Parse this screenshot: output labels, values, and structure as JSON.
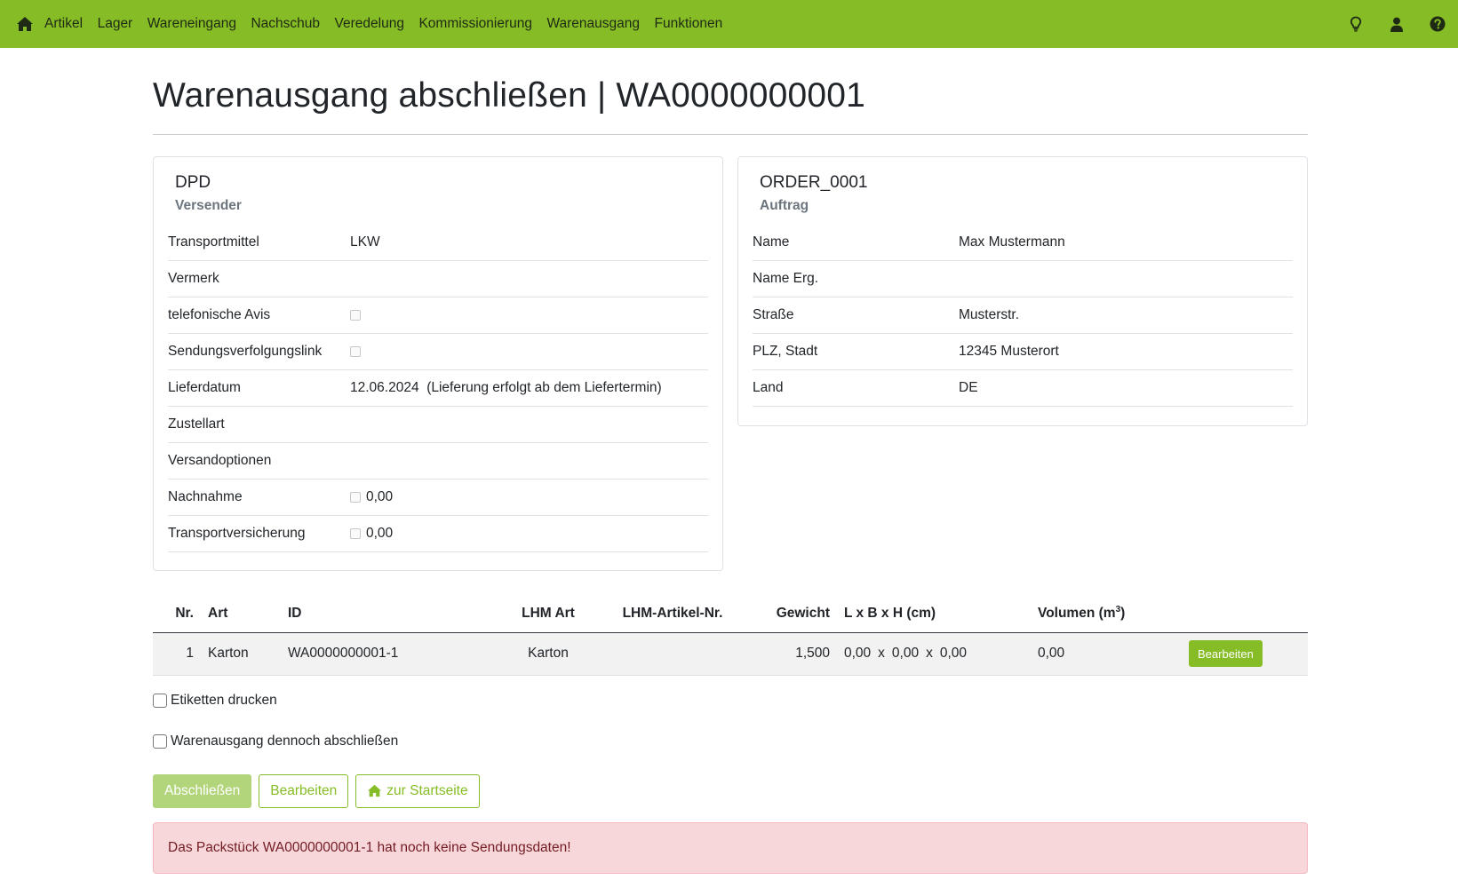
{
  "navbar": {
    "items": [
      "Artikel",
      "Lager",
      "Wareneingang",
      "Nachschub",
      "Veredelung",
      "Kommissionierung",
      "Warenausgang",
      "Funktionen"
    ],
    "icons": [
      "home-icon",
      "lightbulb-icon",
      "user-icon",
      "help-icon"
    ],
    "accent_color": "#86bc25"
  },
  "page": {
    "title": "Warenausgang abschließen | WA0000000001"
  },
  "shipper_card": {
    "title": "DPD",
    "subtitle": "Versender",
    "rows": {
      "transportmittel": {
        "label": "Transportmittel",
        "value": "LKW"
      },
      "vermerk": {
        "label": "Vermerk",
        "value": ""
      },
      "avis": {
        "label": "telefonische Avis",
        "checked": false
      },
      "tracking": {
        "label": "Sendungsverfolgungslink",
        "checked": false
      },
      "lieferdatum": {
        "label": "Lieferdatum",
        "value": "12.06.2024  (Lieferung erfolgt ab dem Liefertermin)"
      },
      "zustellart": {
        "label": "Zustellart",
        "value": ""
      },
      "versandoptionen": {
        "label": "Versandoptionen",
        "value": ""
      },
      "nachnahme": {
        "label": "Nachnahme",
        "checked": false,
        "value": "0,00"
      },
      "versicherung": {
        "label": "Transportversicherung",
        "checked": false,
        "value": "0,00"
      }
    }
  },
  "order_card": {
    "title": "ORDER_0001",
    "subtitle": "Auftrag",
    "rows": {
      "name": {
        "label": "Name",
        "value": "Max Mustermann"
      },
      "name_erg": {
        "label": "Name Erg.",
        "value": ""
      },
      "strasse": {
        "label": "Straße",
        "value": "Musterstr."
      },
      "plz": {
        "label": "PLZ, Stadt",
        "value": "12345 Musterort"
      },
      "land": {
        "label": "Land",
        "value": "DE"
      }
    }
  },
  "packages_table": {
    "headers": {
      "nr": "Nr.",
      "art": "Art",
      "id": "ID",
      "lhm_art": "LHM Art",
      "lhm_nr": "LHM-Artikel-Nr.",
      "gewicht": "Gewicht",
      "dims": "L x B x H (cm)",
      "volumen": "Volumen (m",
      "volumen_sup": "3",
      "volumen_end": ")"
    },
    "rows": [
      {
        "nr": "1",
        "art": "Karton",
        "id": "WA0000000001-1",
        "lhm_art": "Karton",
        "lhm_nr": "",
        "gewicht": "1,500",
        "l": "0,00",
        "b": "0,00",
        "h": "0,00",
        "x": "x",
        "volumen": "0,00",
        "button": "Bearbeiten"
      }
    ]
  },
  "options": {
    "print_labels": {
      "label": "Etiketten drucken",
      "checked": false
    },
    "force_close": {
      "label": "Warenausgang dennoch abschließen",
      "checked": false
    }
  },
  "actions": {
    "close": "Abschließen",
    "edit": "Bearbeiten",
    "home": "zur Startseite"
  },
  "alert": {
    "message": "Das Packstück WA0000000001-1 hat noch keine Sendungsdaten!"
  }
}
